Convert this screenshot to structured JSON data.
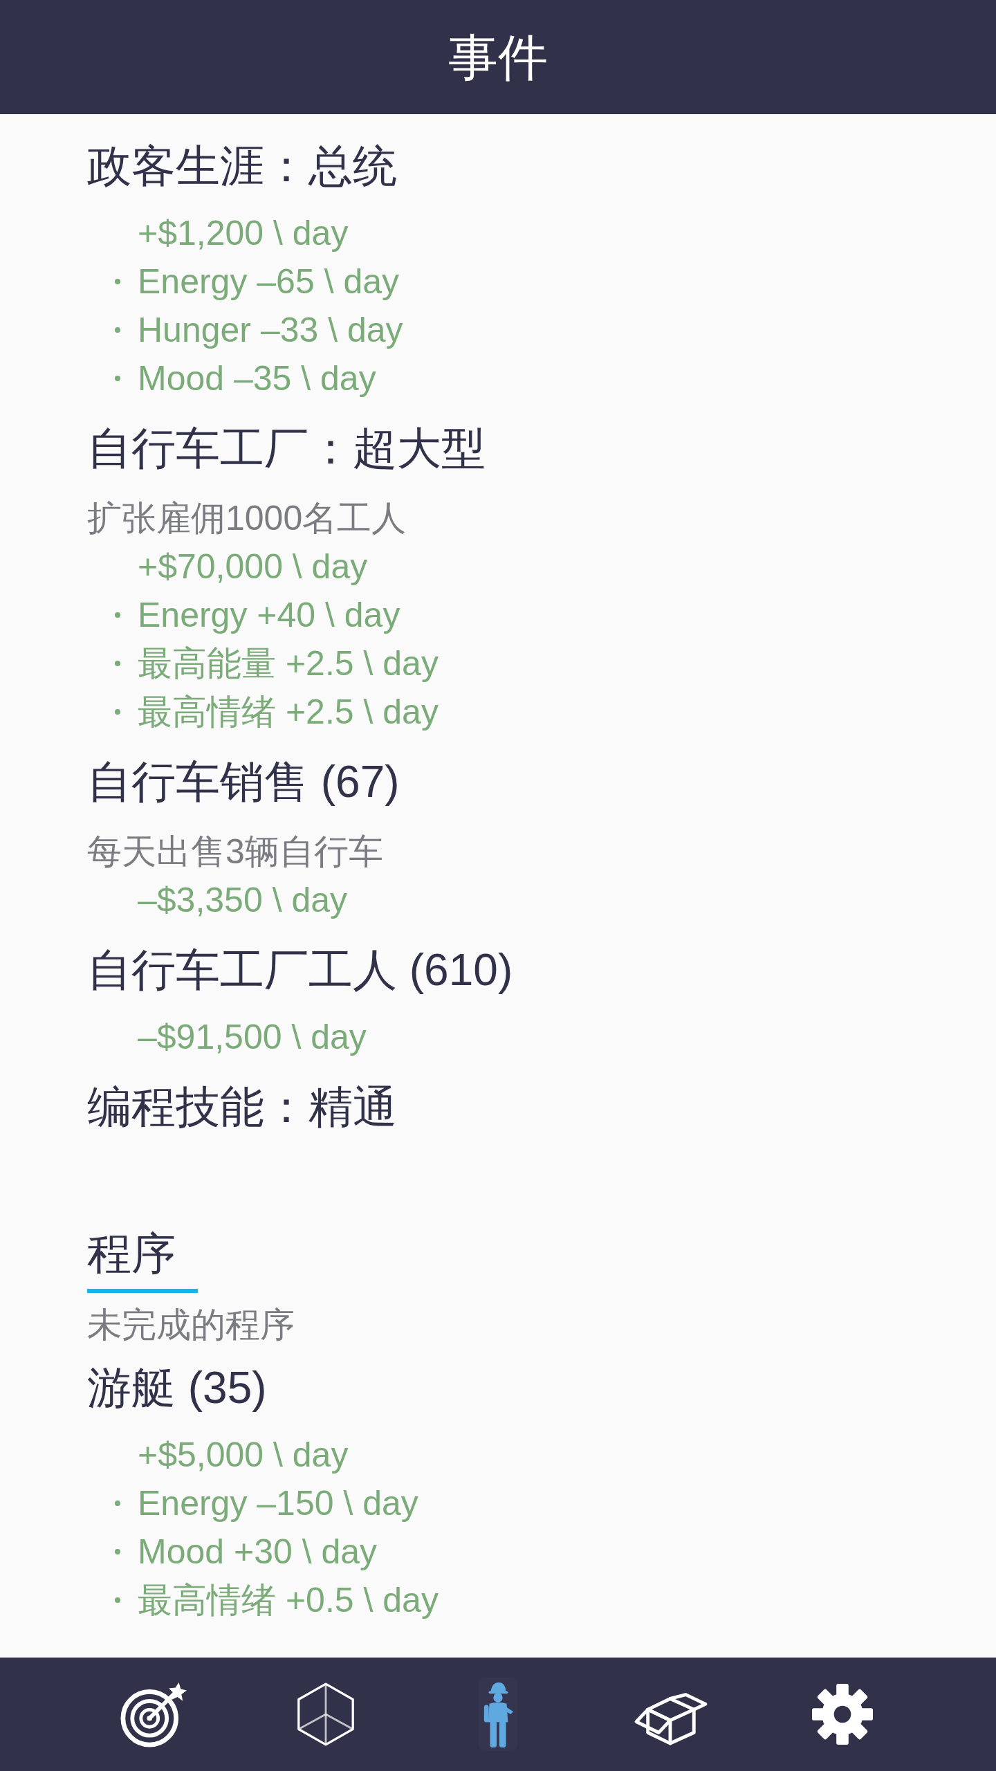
{
  "header": {
    "title": "事件"
  },
  "events": [
    {
      "title": "政客生涯：总统",
      "effects": [
        {
          "text": "+$1,200 \\ day",
          "bullet": false
        },
        {
          "text": "Energy –65 \\ day",
          "bullet": true
        },
        {
          "text": "Hunger –33 \\ day",
          "bullet": true
        },
        {
          "text": "Mood –35 \\ day",
          "bullet": true
        }
      ]
    },
    {
      "title": "自行车工厂：超大型",
      "description": "扩张雇佣1000名工人",
      "effects": [
        {
          "text": "+$70,000 \\ day",
          "bullet": false
        },
        {
          "text": "Energy +40 \\ day",
          "bullet": true
        },
        {
          "text": "最高能量 +2.5 \\ day",
          "bullet": true
        },
        {
          "text": "最高情绪 +2.5 \\ day",
          "bullet": true
        }
      ]
    },
    {
      "title": "自行车销售 (67)",
      "description": "每天出售3辆自行车",
      "effects": [
        {
          "text": "–$3,350 \\ day",
          "bullet": false
        }
      ]
    },
    {
      "title": "自行车工厂工人 (610)",
      "effects": [
        {
          "text": "–$91,500 \\ day",
          "bullet": false
        }
      ]
    },
    {
      "title": "编程技能：精通"
    }
  ],
  "programs": {
    "title": "程序",
    "subtitle": "未完成的程序",
    "items": [
      {
        "title": "游艇 (35)",
        "effects": [
          {
            "text": "+$5,000 \\ day",
            "bullet": false
          },
          {
            "text": "Energy –150 \\ day",
            "bullet": true
          },
          {
            "text": "Mood +30 \\ day",
            "bullet": true
          },
          {
            "text": "最高情绪 +0.5 \\ day",
            "bullet": true
          }
        ]
      }
    ]
  },
  "nav": [
    {
      "kind": "target",
      "selected": false
    },
    {
      "kind": "cube",
      "selected": false
    },
    {
      "kind": "worker",
      "selected": true
    },
    {
      "kind": "box",
      "selected": false
    },
    {
      "kind": "gear",
      "selected": false
    }
  ]
}
